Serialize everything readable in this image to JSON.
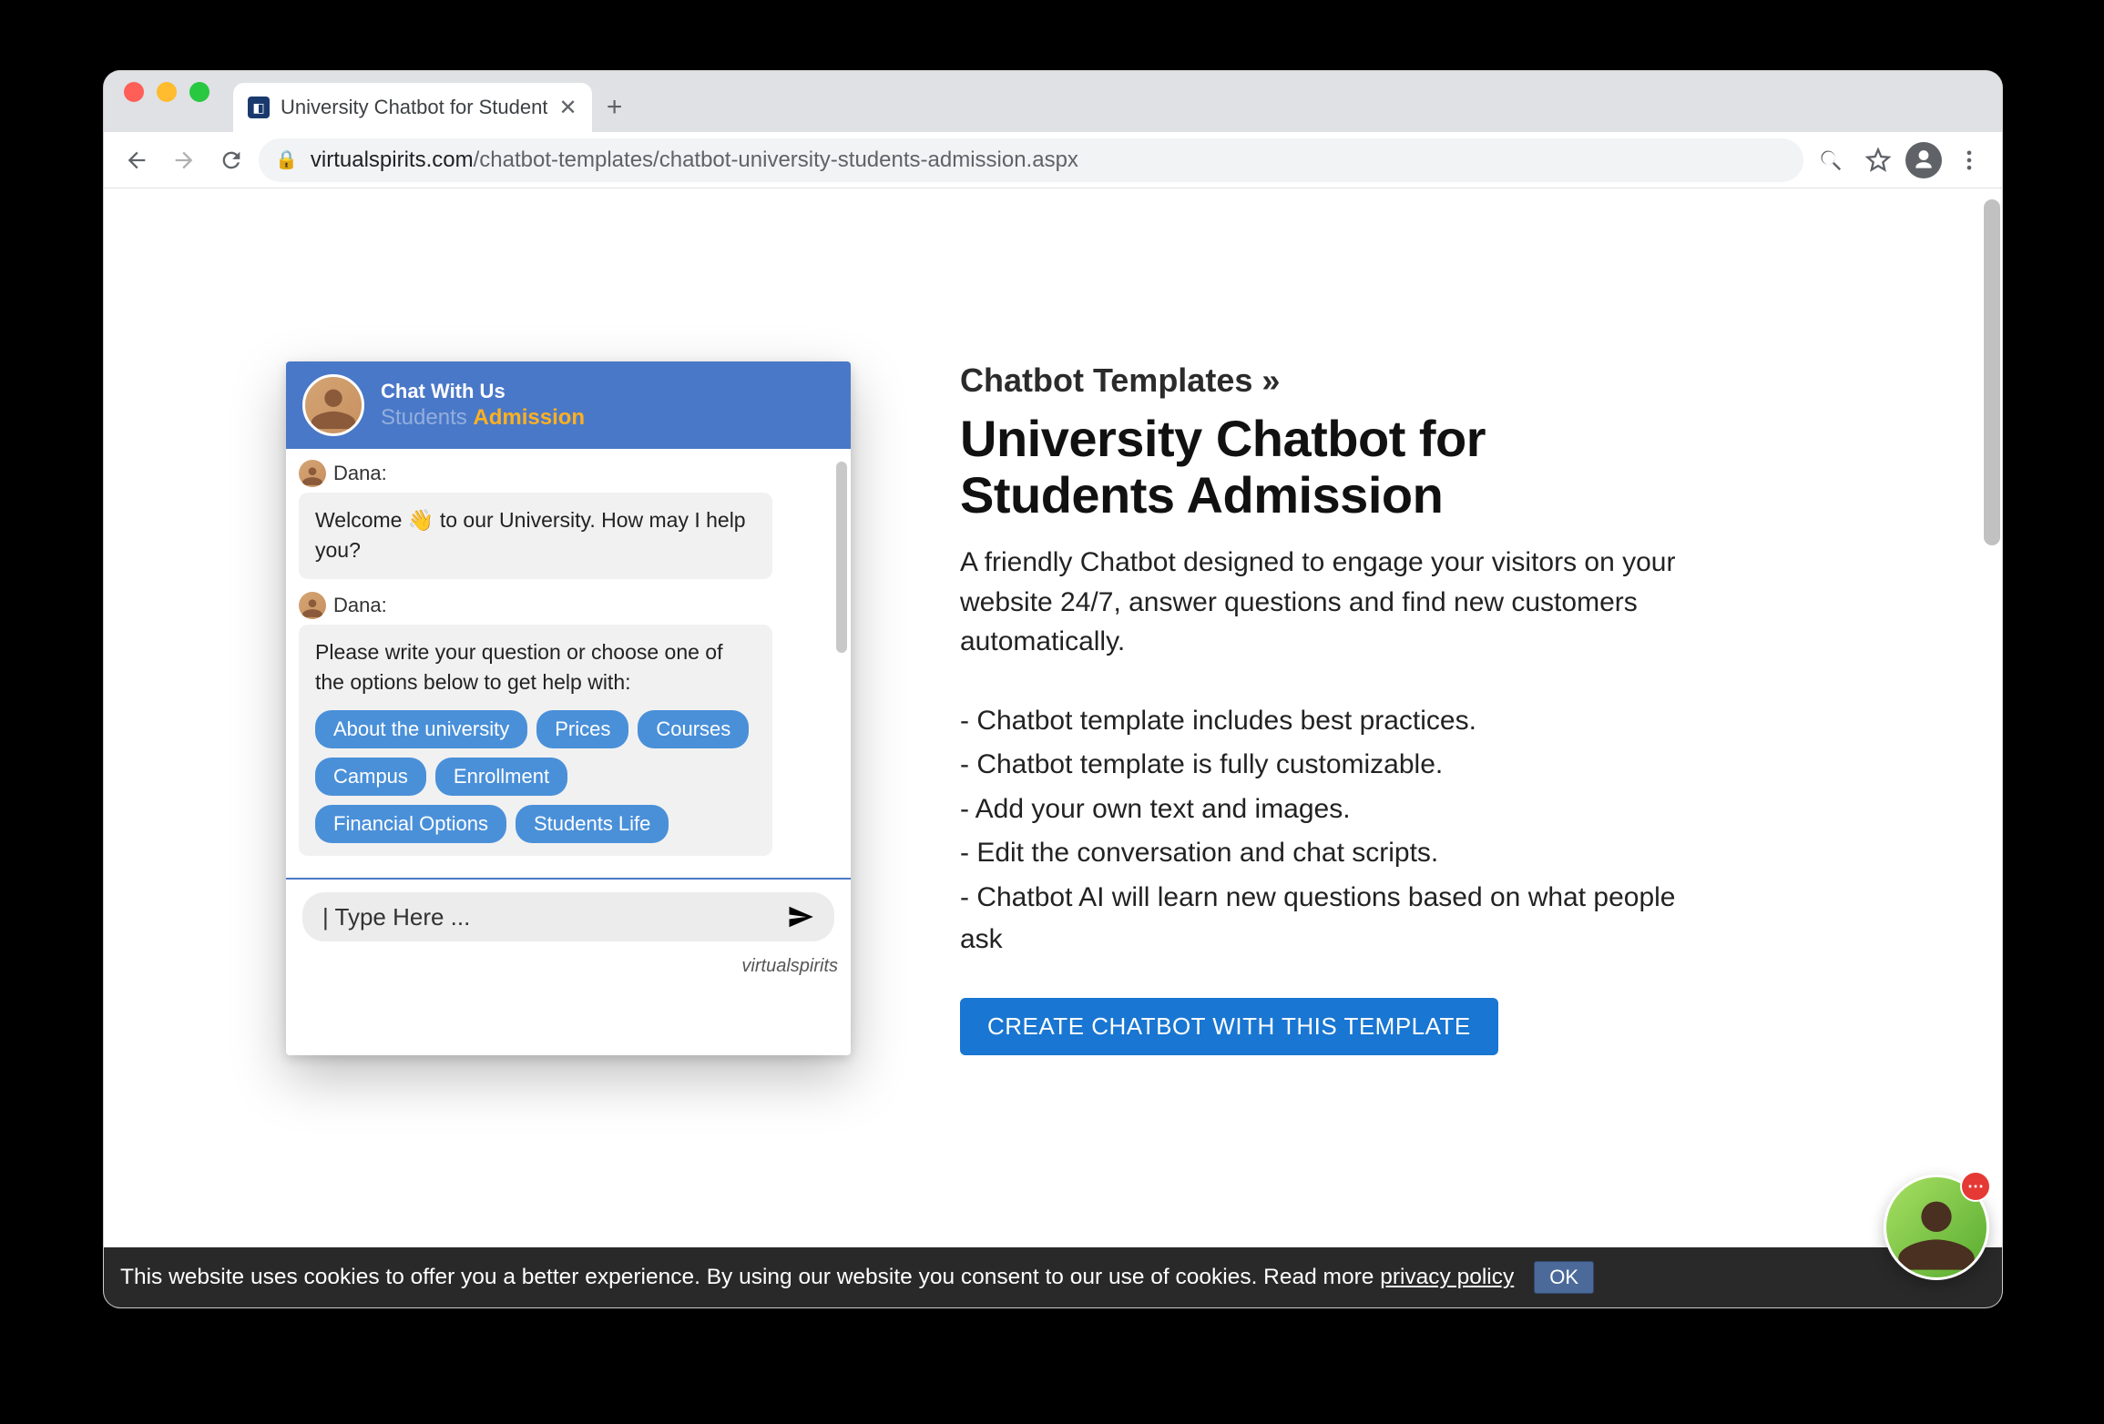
{
  "browser": {
    "tab_title": "University Chatbot for Student",
    "url_domain": "virtualspirits.com",
    "url_path": "/chatbot-templates/chatbot-university-students-admission.aspx"
  },
  "page": {
    "breadcrumb": "Chatbot Templates »",
    "title": "University Chatbot for Students Admission",
    "lead": "A friendly Chatbot designed to engage your visitors on your website 24/7, answer questions and find new customers automatically.",
    "bullets": [
      "- Chatbot template includes best practices.",
      "- Chatbot template is fully customizable.",
      "- Add your own text and images.",
      "- Edit the conversation and chat scripts.",
      "- Chatbot AI will learn new questions based on what people ask"
    ],
    "cta": "CREATE CHATBOT WITH THIS TEMPLATE"
  },
  "widget": {
    "header_small": "Chat With Us",
    "header_muted": "Students ",
    "header_highlight": "Admission",
    "messages": [
      {
        "sender": "Dana:",
        "text": "Welcome 👋 to our University. How may I help you?"
      },
      {
        "sender": "Dana:",
        "text": "Please write your question or choose one of the options below to get help with:"
      }
    ],
    "chips": [
      "About the university",
      "Prices",
      "Courses",
      "Campus",
      "Enrollment",
      "Financial Options",
      "Students Life"
    ],
    "composer_placeholder": "| Type Here ...",
    "brand": "virtualspirits"
  },
  "cookie": {
    "text": "This website uses cookies to offer you a better experience. By using our website you consent to our use of cookies. Read more ",
    "policy": "privacy policy",
    "ok": "OK"
  },
  "help_badge": "⋯"
}
